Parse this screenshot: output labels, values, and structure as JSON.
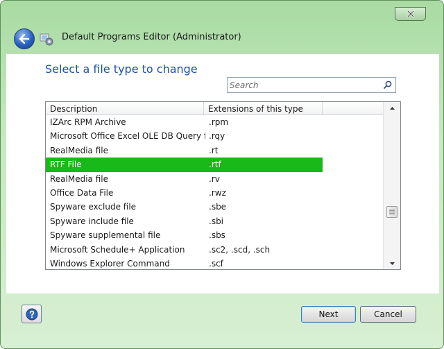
{
  "window": {
    "title": "Default Programs Editor (Administrator)"
  },
  "page": {
    "heading": "Select a file type to change"
  },
  "search": {
    "placeholder": "Search",
    "value": ""
  },
  "list": {
    "columns": [
      "Description",
      "Extensions of this type"
    ],
    "rows": [
      {
        "description": "IZArc RPM Archive",
        "extensions": ".rpm"
      },
      {
        "description": "Microsoft Office Excel OLE DB Query f...",
        "extensions": ".rqy"
      },
      {
        "description": "RealMedia file",
        "extensions": ".rt"
      },
      {
        "description": "RTF File",
        "extensions": ".rtf",
        "selected": true
      },
      {
        "description": "RealMedia file",
        "extensions": ".rv"
      },
      {
        "description": "Office Data File",
        "extensions": ".rwz"
      },
      {
        "description": "Spyware exclude file",
        "extensions": ".sbe"
      },
      {
        "description": "Spyware include file",
        "extensions": ".sbi"
      },
      {
        "description": "Spyware supplemental file",
        "extensions": ".sbs"
      },
      {
        "description": "Microsoft Schedule+ Application",
        "extensions": ".sc2, .scd, .sch"
      },
      {
        "description": "Windows Explorer Command",
        "extensions": ".scf"
      }
    ],
    "selected_color": "#19b919"
  },
  "buttons": {
    "next": "Next",
    "cancel": "Cancel",
    "help_icon": "question-mark-icon"
  },
  "colors": {
    "heading": "#1c4fb0",
    "frame": "#a9dba3"
  }
}
